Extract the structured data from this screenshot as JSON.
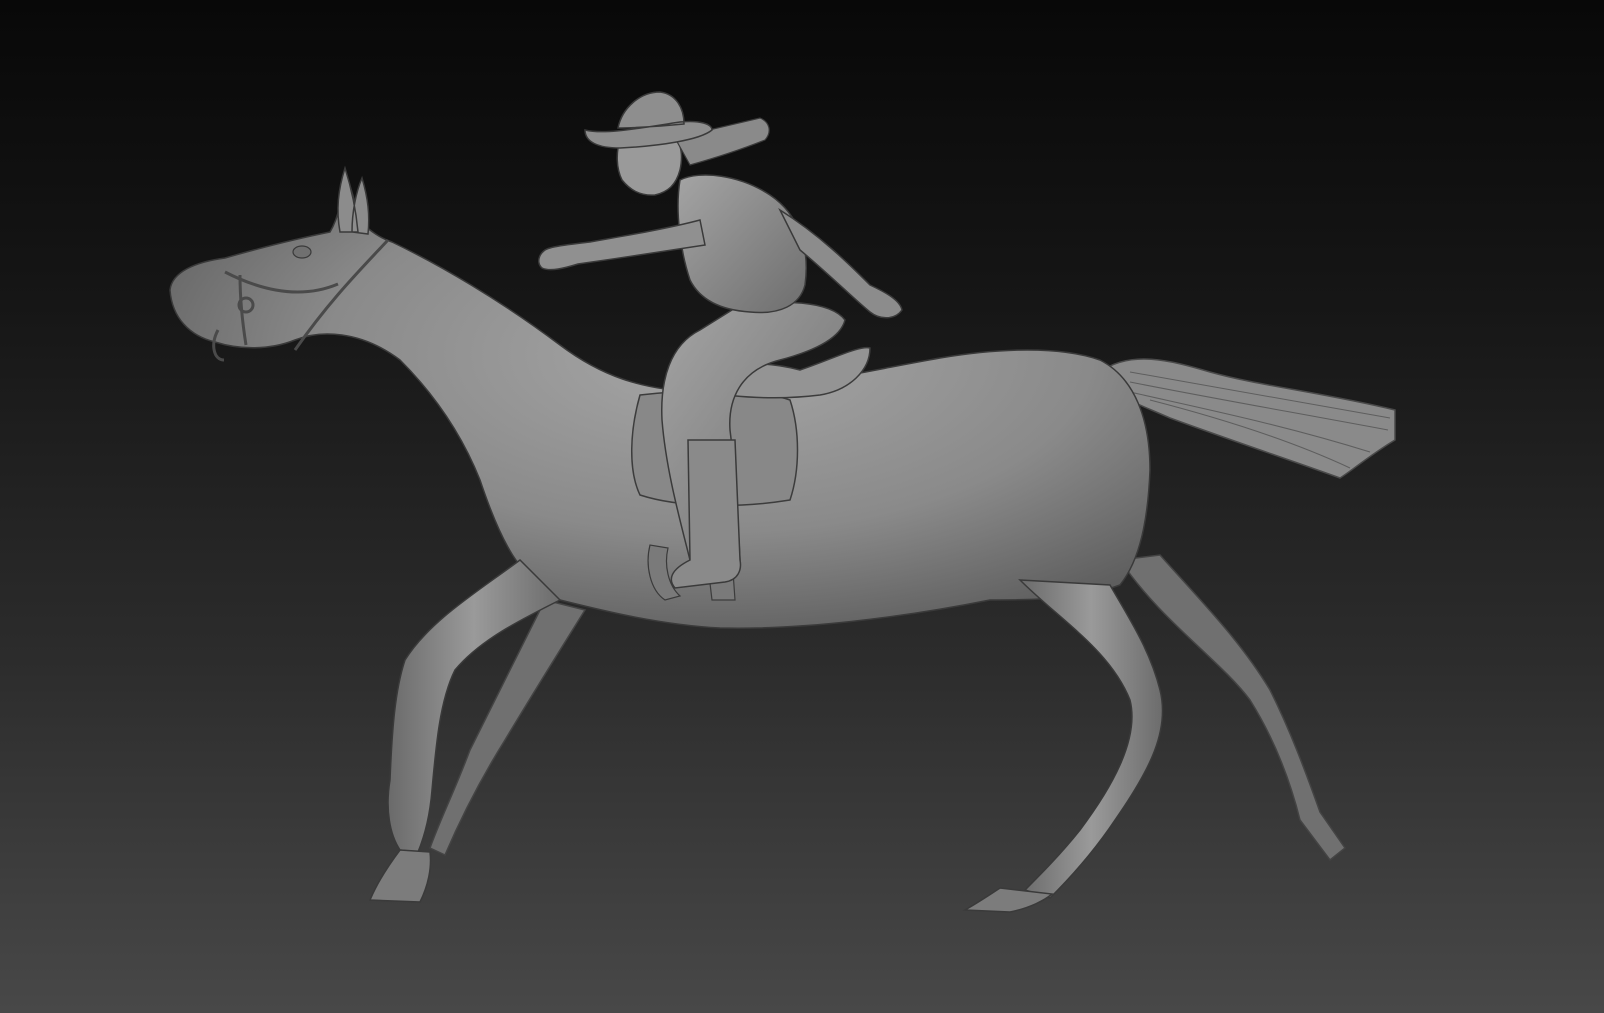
{
  "viewport": {
    "background_top": "#080808",
    "background_bottom": "#484848"
  },
  "model": {
    "subject": "galloping-horse-with-cowgirl-rider",
    "material_color": "#8e8e8e",
    "shade_color": "#5a5a5a",
    "highlight_color": "#b6b6b6",
    "outline_color": "#3a3a3a"
  }
}
